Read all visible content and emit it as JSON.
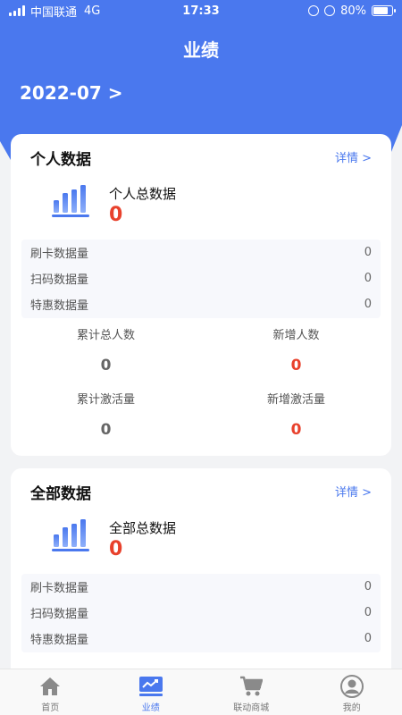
{
  "status_bar": {
    "carrier": "中国联通",
    "network": "4G",
    "time": "17:33",
    "battery": "80%",
    "battery_level": 0.8
  },
  "header": {
    "title": "业绩",
    "month": "2022-07 >"
  },
  "personal": {
    "title": "个人数据",
    "detail": "详情 >",
    "total_label": "个人总数据",
    "total_value": "0",
    "metrics": [
      {
        "label": "刷卡数据量",
        "value": "0"
      },
      {
        "label": "扫码数据量",
        "value": "0"
      },
      {
        "label": "特惠数据量",
        "value": "0"
      }
    ],
    "stats": [
      {
        "label": "累计总人数",
        "value": "0"
      },
      {
        "label": "新增人数",
        "value": "0"
      },
      {
        "label": "累计激活量",
        "value": "0"
      },
      {
        "label": "新增激活量",
        "value": "0"
      }
    ]
  },
  "all": {
    "title": "全部数据",
    "detail": "详情 >",
    "total_label": "全部总数据",
    "total_value": "0",
    "metrics": [
      {
        "label": "刷卡数据量",
        "value": "0"
      },
      {
        "label": "扫码数据量",
        "value": "0"
      },
      {
        "label": "特惠数据量",
        "value": "0"
      }
    ]
  },
  "tabbar": [
    {
      "label": "首页",
      "icon": "home-icon"
    },
    {
      "label": "业绩",
      "icon": "chart-icon"
    },
    {
      "label": "联动商城",
      "icon": "cart-icon"
    },
    {
      "label": "我的",
      "icon": "profile-icon"
    }
  ],
  "colors": {
    "primary": "#4a78ee",
    "accent_red": "#e8412c"
  }
}
